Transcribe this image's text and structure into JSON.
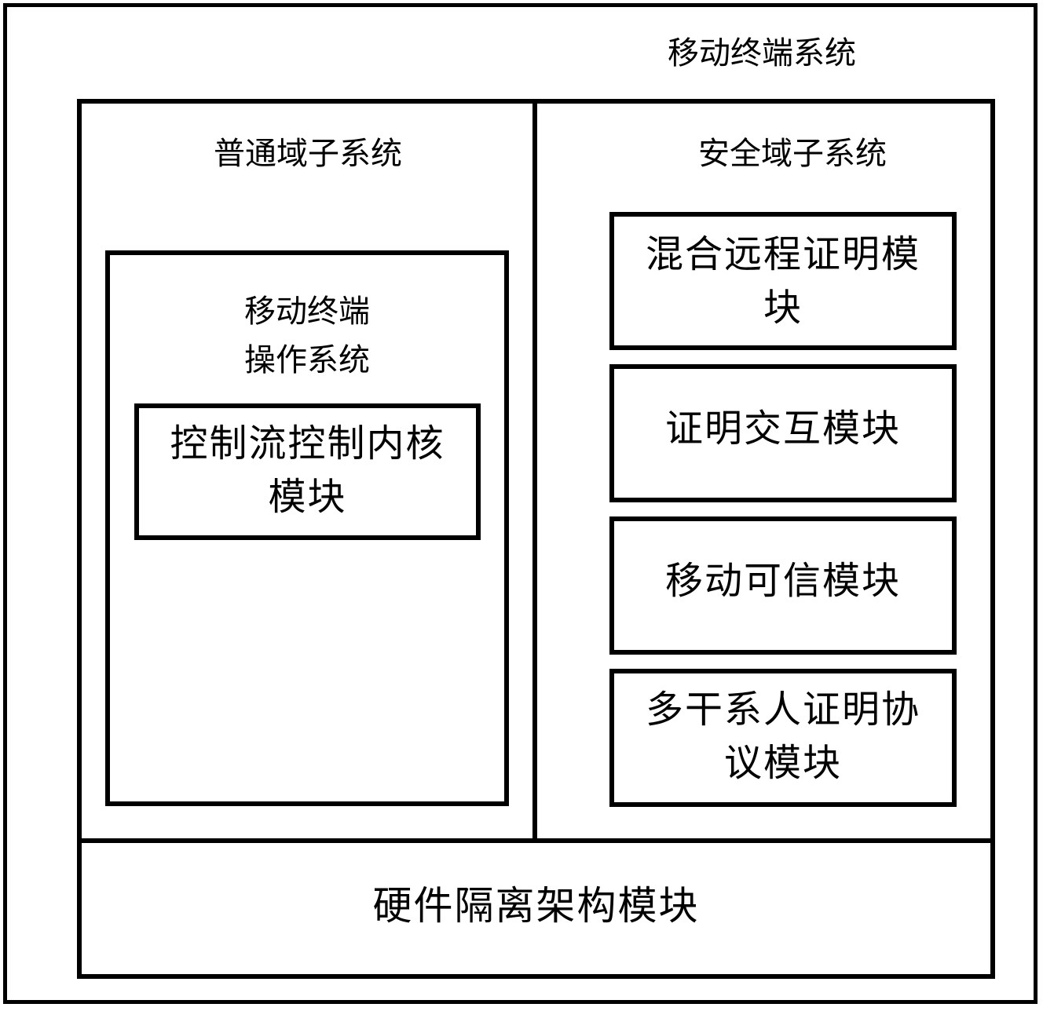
{
  "diagram": {
    "outer": {
      "title": "移动终端系统"
    },
    "normal_domain": {
      "title": "普通域子系统",
      "os": {
        "title": "移动终端\n操作系统",
        "kernel_module": "控制流控制内核\n模块"
      }
    },
    "secure_domain": {
      "title": "安全域子系统",
      "modules": [
        {
          "label": "混合远程证明模\n块"
        },
        {
          "label": "证明交互模块"
        },
        {
          "label": "移动可信模块"
        },
        {
          "label": "多干系人证明协\n议模块"
        }
      ]
    },
    "hardware": {
      "label": "硬件隔离架构模块"
    },
    "colors": {
      "stroke": "#000000",
      "background": "#ffffff",
      "text": "#000000"
    }
  }
}
